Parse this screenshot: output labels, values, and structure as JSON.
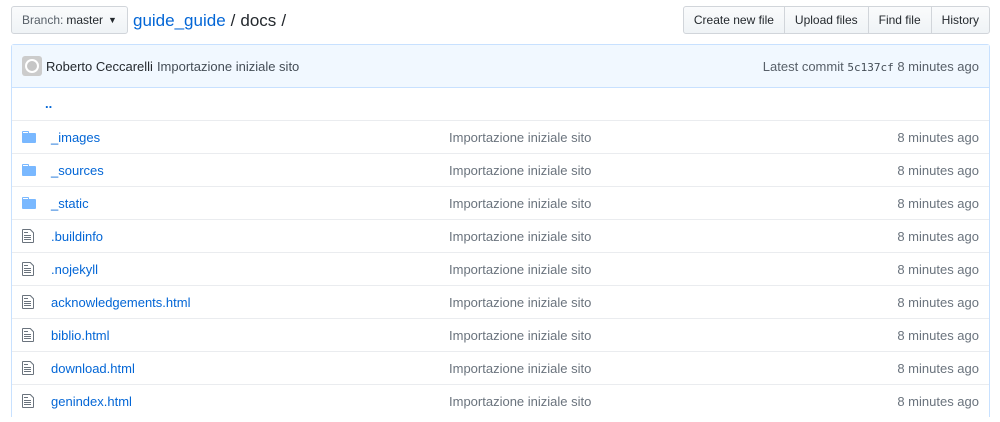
{
  "branch": {
    "label": "Branch:",
    "name": "master"
  },
  "breadcrumb": {
    "repo": "guide_guide",
    "separator": "/",
    "dir": "docs",
    "trailing": "/"
  },
  "actions": {
    "create_new_file": "Create new file",
    "upload_files": "Upload files",
    "find_file": "Find file",
    "history": "History"
  },
  "commit": {
    "author": "Roberto Ceccarelli",
    "message": "Importazione iniziale sito",
    "latest_label": "Latest commit",
    "sha": "5c137cf",
    "age": "8 minutes ago"
  },
  "parent_link": "..",
  "files": [
    {
      "name": "_images",
      "type": "folder",
      "message": "Importazione iniziale sito",
      "age": "8 minutes ago"
    },
    {
      "name": "_sources",
      "type": "folder",
      "message": "Importazione iniziale sito",
      "age": "8 minutes ago"
    },
    {
      "name": "_static",
      "type": "folder",
      "message": "Importazione iniziale sito",
      "age": "8 minutes ago"
    },
    {
      "name": ".buildinfo",
      "type": "file",
      "message": "Importazione iniziale sito",
      "age": "8 minutes ago"
    },
    {
      "name": ".nojekyll",
      "type": "file",
      "message": "Importazione iniziale sito",
      "age": "8 minutes ago"
    },
    {
      "name": "acknowledgements.html",
      "type": "file",
      "message": "Importazione iniziale sito",
      "age": "8 minutes ago"
    },
    {
      "name": "biblio.html",
      "type": "file",
      "message": "Importazione iniziale sito",
      "age": "8 minutes ago"
    },
    {
      "name": "download.html",
      "type": "file",
      "message": "Importazione iniziale sito",
      "age": "8 minutes ago"
    },
    {
      "name": "genindex.html",
      "type": "file",
      "message": "Importazione iniziale sito",
      "age": "8 minutes ago"
    }
  ],
  "colors": {
    "link": "#0366d6",
    "folder_icon": "#79b8ff",
    "file_icon": "#6a737d",
    "commit_bg": "#f1f8ff"
  }
}
